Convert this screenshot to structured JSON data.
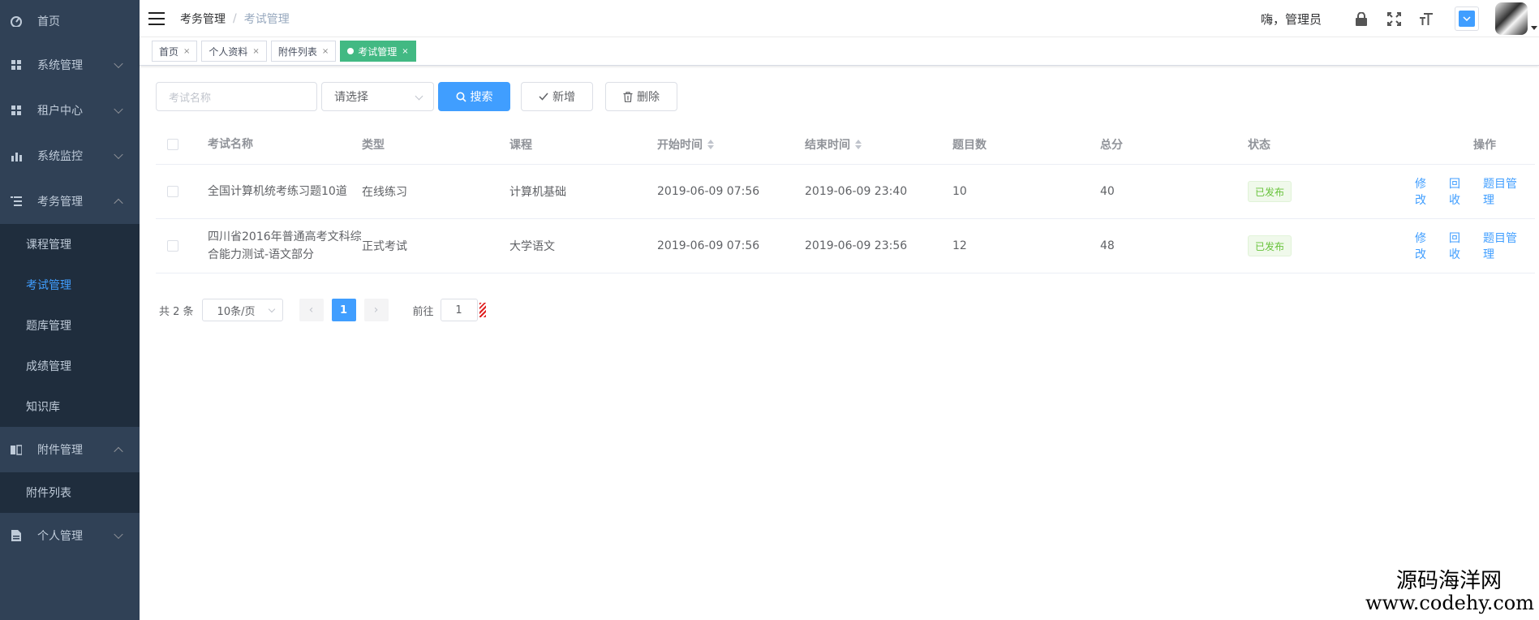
{
  "sidebar": {
    "items": [
      {
        "label": "首页",
        "icon": "dashboard-icon"
      },
      {
        "label": "系统管理",
        "icon": "grid-icon"
      },
      {
        "label": "租户中心",
        "icon": "grid-icon"
      },
      {
        "label": "系统监控",
        "icon": "bar-chart-icon"
      },
      {
        "label": "考务管理",
        "icon": "list-icon"
      },
      {
        "label": "附件管理",
        "icon": "book-icon"
      },
      {
        "label": "个人管理",
        "icon": "document-icon"
      }
    ],
    "exam_submenu": [
      "课程管理",
      "考试管理",
      "题库管理",
      "成绩管理",
      "知识库"
    ],
    "attachment_submenu": [
      "附件列表"
    ],
    "active_color": "#409eff",
    "bg_color": "#304156"
  },
  "header": {
    "breadcrumb": [
      "考务管理",
      "考试管理"
    ],
    "breadcrumb_sep": "/",
    "greeting": "嗨，管理员"
  },
  "tags": [
    {
      "label": "首页",
      "active": false
    },
    {
      "label": "个人资料",
      "active": false
    },
    {
      "label": "附件列表",
      "active": false
    },
    {
      "label": "考试管理",
      "active": true
    }
  ],
  "toolbar": {
    "search_placeholder": "考试名称",
    "type_select": "请选择",
    "search_label": "搜索",
    "add_label": "新增",
    "delete_label": "删除"
  },
  "table": {
    "headers": [
      "考试名称",
      "类型",
      "课程",
      "开始时间",
      "结束时间",
      "题目数",
      "总分",
      "状态",
      "操作"
    ],
    "rows": [
      {
        "name": "全国计算机统考练习题10道",
        "type": "在线练习",
        "course": "计算机基础",
        "start": "2019-06-09 07:56",
        "end": "2019-06-09 23:40",
        "questions": "10",
        "score": "40",
        "status": "已发布"
      },
      {
        "name": "四川省2016年普通高考文科综合能力测试-语文部分",
        "type": "正式考试",
        "course": "大学语文",
        "start": "2019-06-09 07:56",
        "end": "2019-06-09 23:56",
        "questions": "12",
        "score": "48",
        "status": "已发布"
      }
    ],
    "ops": [
      "修改",
      "回收",
      "题目管理"
    ]
  },
  "pagination": {
    "total_text": "共 2 条",
    "page_size": "10条/页",
    "current_page": "1",
    "goto_label": "前往",
    "goto_value": "1"
  },
  "watermark": {
    "cn": "源码海洋网",
    "url": "www.codehy.com"
  }
}
